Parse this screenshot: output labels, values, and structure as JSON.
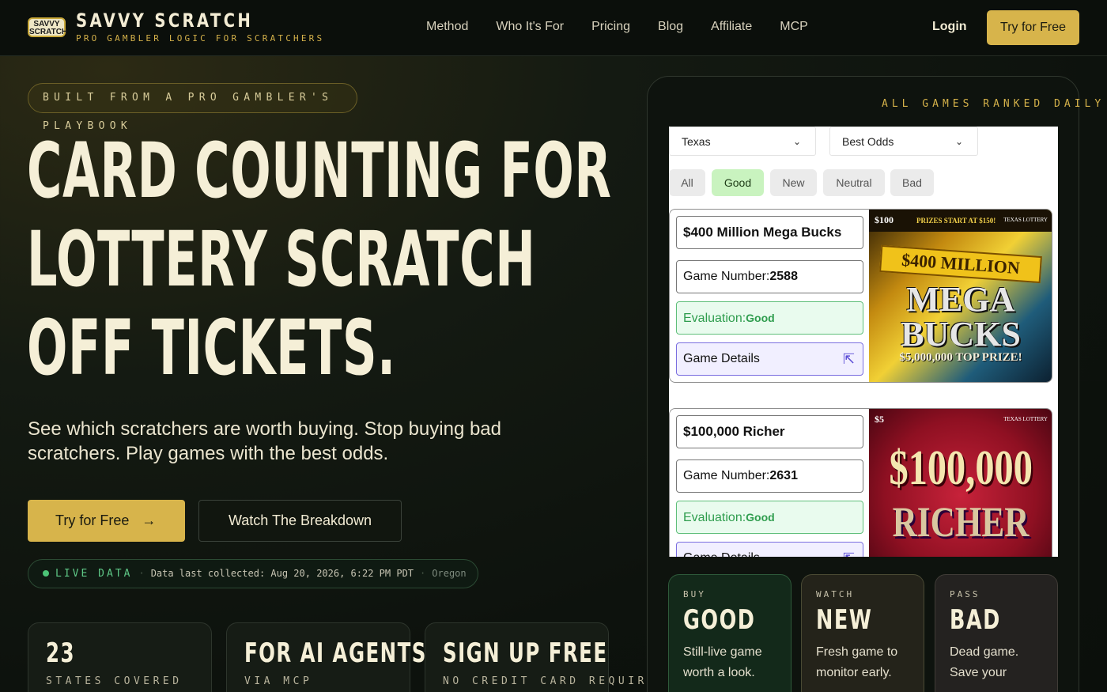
{
  "brand": {
    "logo_text": "SAVVY SCRATCH",
    "title": "SAVVY SCRATCH",
    "subtitle": "PRO GAMBLER LOGIC FOR SCRATCHERS"
  },
  "nav": {
    "links": [
      "Method",
      "Who It's For",
      "Pricing",
      "Blog",
      "Affiliate",
      "MCP"
    ],
    "login": "Login",
    "cta": "Try for Free"
  },
  "hero": {
    "pill": "BUILT FROM A PRO GAMBLER'S PLAYBOOK",
    "headline": [
      "CARD COUNTING FOR",
      "LOTTERY SCRATCH",
      "OFF TICKETS."
    ],
    "description": "See which scratchers are worth buying. Stop buying bad scratchers. Play games with the best odds.",
    "primary_cta": "Try for Free",
    "primary_arrow": "→",
    "secondary_cta": "Watch The Breakdown"
  },
  "live": {
    "label": "LIVE DATA",
    "separator": "·",
    "info": "Data last collected: Aug 20, 2026, 6:22 PM PDT",
    "state": "Oregon"
  },
  "stats": [
    {
      "big": "23",
      "small": "STATES COVERED"
    },
    {
      "big": "FOR AI AGENTS",
      "small": "VIA MCP"
    },
    {
      "big": "SIGN UP FREE",
      "small": "NO CREDIT CARD REQUIRED"
    }
  ],
  "panel": {
    "label": "ALL GAMES RANKED DAILY",
    "state_select": "Texas",
    "sort_select": "Best Odds",
    "chevron": "⌄",
    "filters": [
      "All",
      "Good",
      "New",
      "Neutral",
      "Bad"
    ],
    "active_filter": "Good",
    "game_number_label": "Game Number:",
    "evaluation_label": "Evaluation:",
    "details_label": "Game Details",
    "cursor_icon": "⇱",
    "games": [
      {
        "name": "$400 Million Mega Bucks",
        "number": "2588",
        "evaluation": "Good",
        "ticket": {
          "price": "$100",
          "prizes": "PRIZES START AT $150!",
          "lottery": "TEXAS LOTTERY",
          "banner": "$400 MILLION",
          "headline": "MEGA BUCKS",
          "top_prize": "$5,000,000 TOP PRIZE!"
        }
      },
      {
        "name": "$100,000 Richer",
        "number": "2631",
        "evaluation": "Good",
        "ticket": {
          "price": "$5",
          "lottery": "TEXAS LOTTERY",
          "amount": "$100,000",
          "headline": "RICHER"
        }
      }
    ]
  },
  "evaluations": [
    {
      "tag": "BUY",
      "word": "GOOD",
      "desc": "Still-live game worth a look."
    },
    {
      "tag": "WATCH",
      "word": "NEW",
      "desc": "Fresh game to monitor early."
    },
    {
      "tag": "PASS",
      "word": "BAD",
      "desc": "Dead game. Save your"
    }
  ],
  "colors": {
    "accent": "#d7b44b",
    "background": "#0d120d",
    "live_green": "#4cc477",
    "good_green": "#2f9d4e"
  }
}
